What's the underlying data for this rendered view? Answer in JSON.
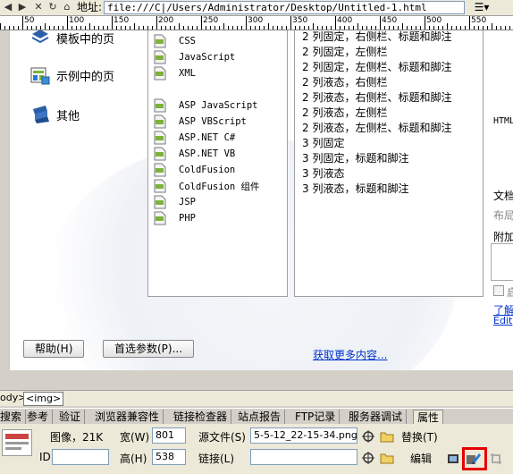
{
  "address_bar": {
    "label": "地址:",
    "url": "file:///C|/Users/Administrator/Desktop/Untitled-1.html",
    "menu_glyph": "☰▾"
  },
  "ruler": {
    "labels": [
      "50",
      "100",
      "150",
      "200",
      "250",
      "300",
      "350",
      "400",
      "450",
      "500",
      "550"
    ]
  },
  "welcome": {
    "left_links": [
      {
        "label": "模板中的页",
        "icon": "template-icon"
      },
      {
        "label": "示例中的页",
        "icon": "sample-page-icon"
      },
      {
        "label": "其他",
        "icon": "other-icon"
      }
    ],
    "file_types": [
      "CSS",
      "JavaScript",
      "XML",
      "ASP JavaScript",
      "ASP VBScript",
      "ASP.NET C#",
      "ASP.NET VB",
      "ColdFusion",
      "ColdFusion 组件",
      "JSP",
      "PHP"
    ],
    "layouts": [
      "2 列固定，右侧栏、标题和脚注",
      "2 列固定，左侧栏",
      "2 列固定，左侧栏、标题和脚注",
      "2 列液态，右侧栏",
      "2 列液态，右侧栏、标题和脚注",
      "2 列液态，左侧栏",
      "2 列液态，左侧栏、标题和脚注",
      "3 列固定",
      "3 列固定，标题和脚注",
      "3 列液态",
      "3 列液态，标题和脚注"
    ],
    "right_texts": [
      "HTML",
      "文档",
      "布局",
      "附加",
      "启",
      "了解",
      "Edit"
    ],
    "help_button": "帮助(H)",
    "prefs_button": "首选参数(P)...",
    "more_link": "获取更多内容..."
  },
  "tag_selector": {
    "body": "ody>",
    "img": "<img>"
  },
  "tabs": [
    "搜索",
    "参考",
    "验证",
    "浏览器兼容性",
    "链接检查器",
    "站点报告",
    "FTP记录",
    "服务器调试",
    "属性"
  ],
  "active_tab": "属性",
  "properties": {
    "image_label": "图像，21K",
    "id_label": "ID",
    "id_value": "",
    "width_label": "宽(W)",
    "width_value": "801",
    "height_label": "高(H)",
    "height_value": "538",
    "src_label": "源文件(S)",
    "src_value": "5-5-12_22-15-34.png",
    "link_label": "链接(L)",
    "link_value": "",
    "replace_label": "替换(T)",
    "edit_label": "编辑"
  },
  "colors": {
    "highlight": "#e60000",
    "link": "#0033cc",
    "panel": "#ece9d8"
  }
}
